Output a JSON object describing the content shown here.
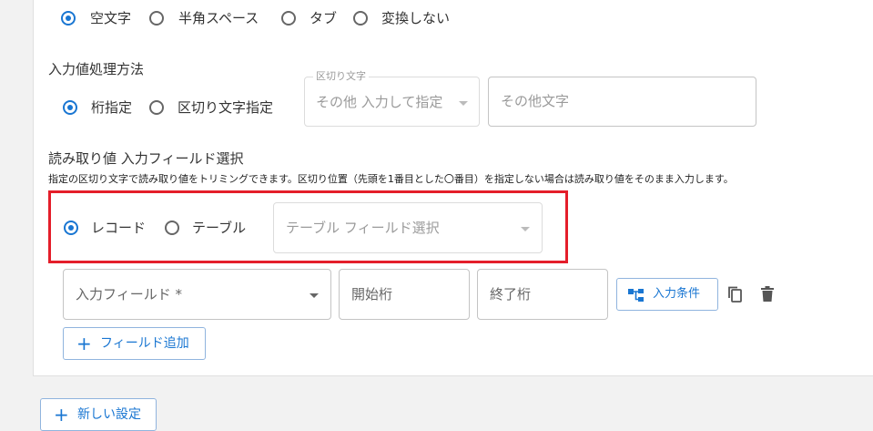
{
  "top_radio": {
    "options": [
      "空文字",
      "半角スペース",
      "タブ",
      "変換しない"
    ],
    "selected": 0
  },
  "input_processing": {
    "title": "入力値処理方法",
    "options": [
      "桁指定",
      "区切り文字指定"
    ],
    "selected": 0,
    "delimiter_select": {
      "legend": "区切り文字",
      "placeholder": "その他 入力して指定"
    },
    "other_char": {
      "placeholder": "その他文字"
    }
  },
  "read_value": {
    "title": "読み取り値 入力フィールド選択",
    "help": "指定の区切り文字で読み取り値をトリミングできます。区切り位置（先頭を1番目とした〇番目）を指定しない場合は読み取り値をそのまま入力します。",
    "options": [
      "レコード",
      "テーブル"
    ],
    "selected": 0,
    "table_field_select": {
      "placeholder": "テーブル フィールド選択"
    }
  },
  "field_row": {
    "input_field": {
      "placeholder": "入力フィールド *"
    },
    "start_digit": {
      "placeholder": "開始桁"
    },
    "end_digit": {
      "placeholder": "終了桁"
    },
    "condition_button": {
      "label": "入力条件",
      "icon": "hierarchy-icon"
    },
    "copy_icon": "copy-icon",
    "delete_icon": "trash-icon"
  },
  "add_field_button": {
    "label": "フィールド追加"
  },
  "new_setting_button": {
    "label": "新しい設定"
  },
  "colors": {
    "accent": "#1976d2",
    "highlight": "#e41e2a"
  }
}
